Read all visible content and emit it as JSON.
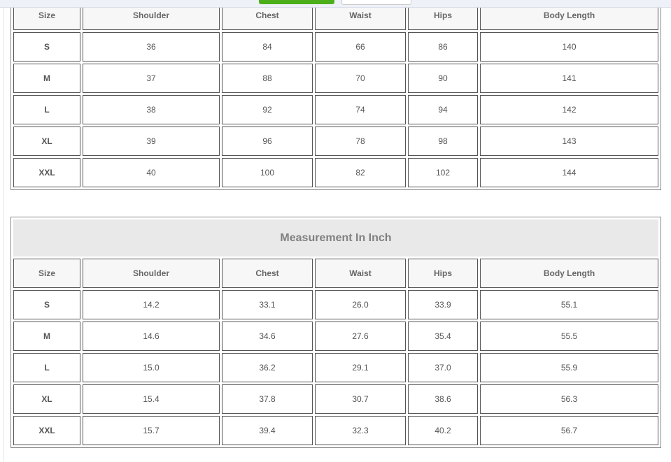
{
  "toolbar": {
    "buttons": [
      {
        "color": "#4caf1a"
      },
      {
        "color": "#ffffff"
      }
    ]
  },
  "cm_table": {
    "headers": [
      "Size",
      "Shoulder",
      "Chest",
      "Waist",
      "Hips",
      "Body Length"
    ],
    "rows": [
      [
        "S",
        "36",
        "84",
        "66",
        "86",
        "140"
      ],
      [
        "M",
        "37",
        "88",
        "70",
        "90",
        "141"
      ],
      [
        "L",
        "38",
        "92",
        "74",
        "94",
        "142"
      ],
      [
        "XL",
        "39",
        "96",
        "78",
        "98",
        "143"
      ],
      [
        "XXL",
        "40",
        "100",
        "82",
        "102",
        "144"
      ]
    ]
  },
  "inch_table": {
    "title": "Measurement In Inch",
    "headers": [
      "Size",
      "Shoulder",
      "Chest",
      "Waist",
      "Hips",
      "Body Length"
    ],
    "rows": [
      [
        "S",
        "14.2",
        "33.1",
        "26.0",
        "33.9",
        "55.1"
      ],
      [
        "M",
        "14.6",
        "34.6",
        "27.6",
        "35.4",
        "55.5"
      ],
      [
        "L",
        "15.0",
        "36.2",
        "29.1",
        "37.0",
        "55.9"
      ],
      [
        "XL",
        "15.4",
        "37.8",
        "30.7",
        "38.6",
        "56.3"
      ],
      [
        "XXL",
        "15.7",
        "39.4",
        "32.3",
        "40.2",
        "56.7"
      ]
    ]
  }
}
